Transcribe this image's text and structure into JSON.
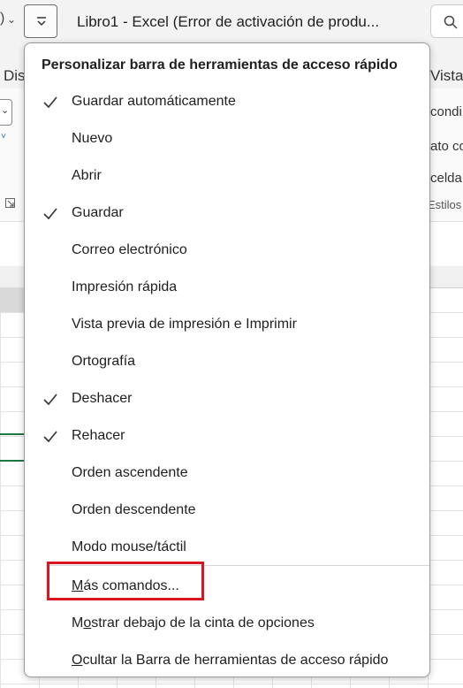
{
  "titlebar": {
    "left_glyph": ")",
    "left_chevron": "⌄",
    "window_title": "Libro1  -  Excel (Error de activación de produ..."
  },
  "ribbon": {
    "tab_left": "Dis",
    "tab_right": "Vista",
    "left_dropdown_chevron": "⌄",
    "left_chevron": "˅",
    "right_items": [
      "condi",
      "ato co",
      "celda"
    ],
    "group_label": "Estilos"
  },
  "menu": {
    "header": "Personalizar barra de herramientas de acceso rápido",
    "items": [
      {
        "label": "Guardar automáticamente",
        "checked": true
      },
      {
        "label": "Nuevo",
        "checked": false
      },
      {
        "label": "Abrir",
        "checked": false
      },
      {
        "label": "Guardar",
        "checked": true
      },
      {
        "label": "Correo electrónico",
        "checked": false
      },
      {
        "label": "Impresión rápida",
        "checked": false
      },
      {
        "label": "Vista previa de impresión e Imprimir",
        "checked": false
      },
      {
        "label": "Ortografía",
        "checked": false
      },
      {
        "label": "Deshacer",
        "checked": true
      },
      {
        "label": "Rehacer",
        "checked": true
      },
      {
        "label": "Orden ascendente",
        "checked": false
      },
      {
        "label": "Orden descendente",
        "checked": false
      },
      {
        "label": "Modo mouse/táctil",
        "checked": false
      }
    ],
    "more_commands": {
      "access_key": "M",
      "rest": "ás comandos..."
    },
    "show_below": {
      "pre": "M",
      "access_key": "o",
      "rest": "strar debajo de la cinta de opciones"
    },
    "hide_toolbar": {
      "access_key": "O",
      "rest": "cultar la Barra de herramientas de acceso rápido"
    }
  },
  "colors": {
    "highlight": "#d9161f",
    "sheet_green": "#1d7a45"
  }
}
